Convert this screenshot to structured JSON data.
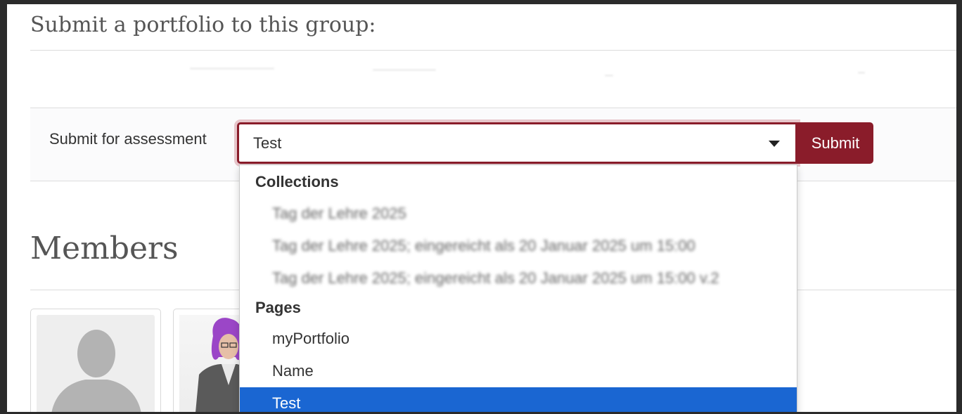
{
  "section": {
    "title": "Submit a portfolio to this group:"
  },
  "submit_form": {
    "label": "Submit for assessment",
    "selected_value": "Test",
    "submit_label": "Submit"
  },
  "dropdown": {
    "groups": [
      {
        "label": "Collections",
        "options": [
          "Tag der Lehre 2025",
          "Tag der Lehre 2025; eingereicht als 20 Januar 2025 um 15:00",
          "Tag der Lehre 2025; eingereicht als 20 Januar 2025 um 15:00 v.2"
        ]
      },
      {
        "label": "Pages",
        "options": [
          "myPortfolio",
          "Name",
          "Test"
        ]
      }
    ],
    "selected": "Test"
  },
  "members": {
    "title": "Members"
  },
  "colors": {
    "brand": "#8a1c2a",
    "selection": "#1a66d2",
    "avatar_placeholder": "#b3b3b3",
    "hair": "#9b46c7"
  }
}
